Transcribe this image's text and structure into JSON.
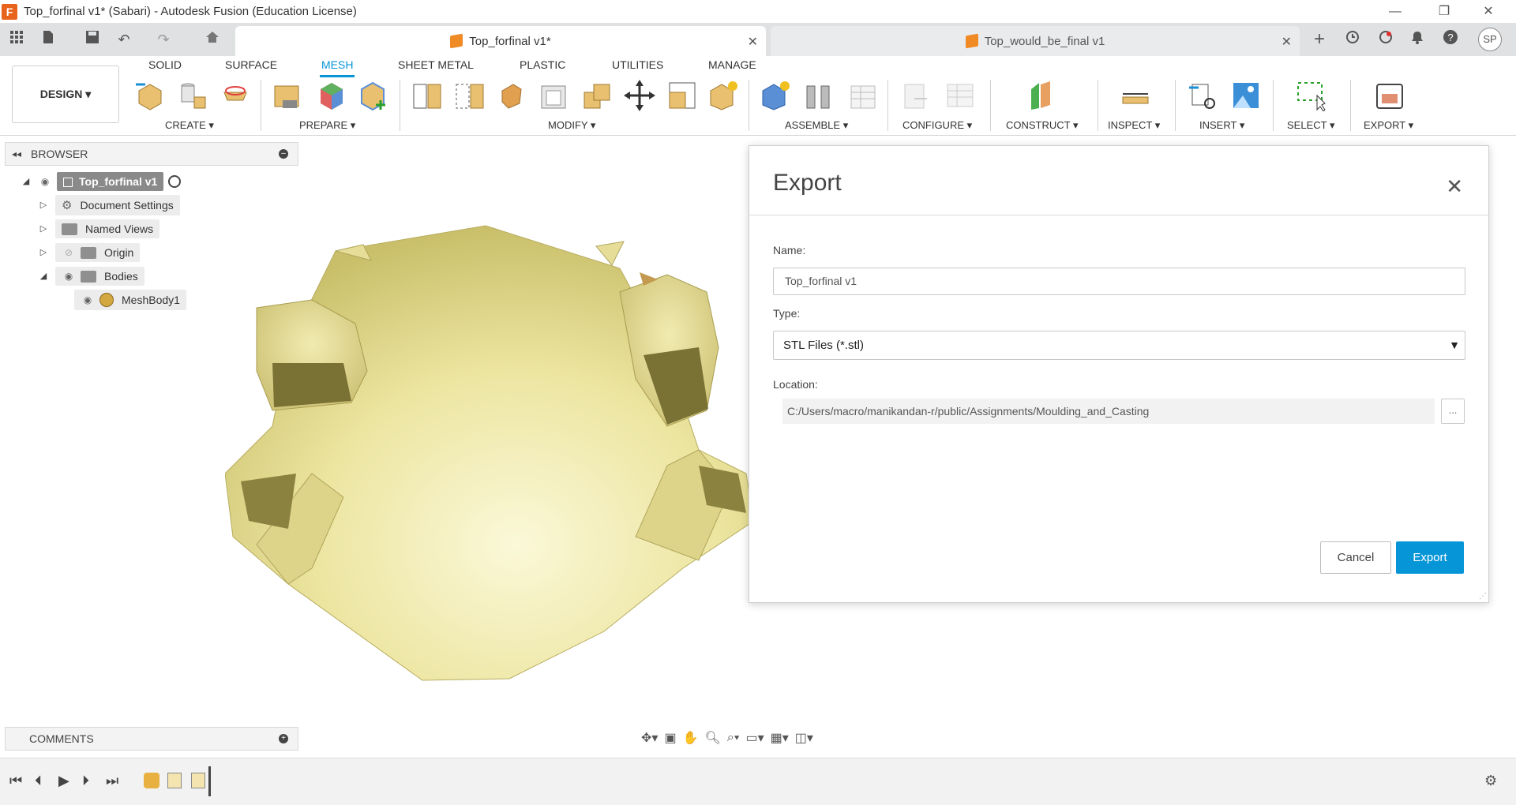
{
  "window": {
    "title": "Top_forfinal v1* (Sabari) - Autodesk Fusion (Education License)",
    "app_icon": "F",
    "minimize": "—",
    "maximize": "❐",
    "close": "✕"
  },
  "tabs": {
    "active_label": "Top_forfinal v1*",
    "inactive_label": "Top_would_be_final v1",
    "close": "✕",
    "user_initials": "SP"
  },
  "ribbon": {
    "design_label": "DESIGN ▾",
    "tabs": [
      "SOLID",
      "SURFACE",
      "MESH",
      "SHEET METAL",
      "PLASTIC",
      "UTILITIES",
      "MANAGE"
    ],
    "active_tab": "MESH",
    "groups": [
      "CREATE ▾",
      "PREPARE ▾",
      "MODIFY ▾",
      "ASSEMBLE ▾",
      "CONFIGURE ▾",
      "CONSTRUCT ▾",
      "INSPECT ▾",
      "INSERT ▾",
      "SELECT ▾",
      "EXPORT ▾"
    ]
  },
  "browser": {
    "header": "BROWSER",
    "root": "Top_forfinal v1",
    "items": [
      "Document Settings",
      "Named Views",
      "Origin",
      "Bodies",
      "MeshBody1"
    ]
  },
  "comments": {
    "label": "COMMENTS"
  },
  "dialog": {
    "title": "Export",
    "close": "✕",
    "name_label": "Name:",
    "name_value": "Top_forfinal v1",
    "type_label": "Type:",
    "type_value": "STL Files (*.stl)",
    "location_label": "Location:",
    "location_value": "C:/Users/macro/manikandan-r/public/Assignments/Moulding_and_Casting",
    "browse_label": "...",
    "cancel_label": "Cancel",
    "export_label": "Export"
  },
  "colors": {
    "accent": "#0696d7",
    "model_fill": "#efe9a6",
    "annotation_arrow": "#e02020"
  },
  "icons": {
    "grid": "grid-icon",
    "file": "file-icon",
    "save": "save-icon",
    "undo": "undo-icon",
    "redo": "redo-icon",
    "home": "home-icon",
    "settings": "gear-icon"
  }
}
